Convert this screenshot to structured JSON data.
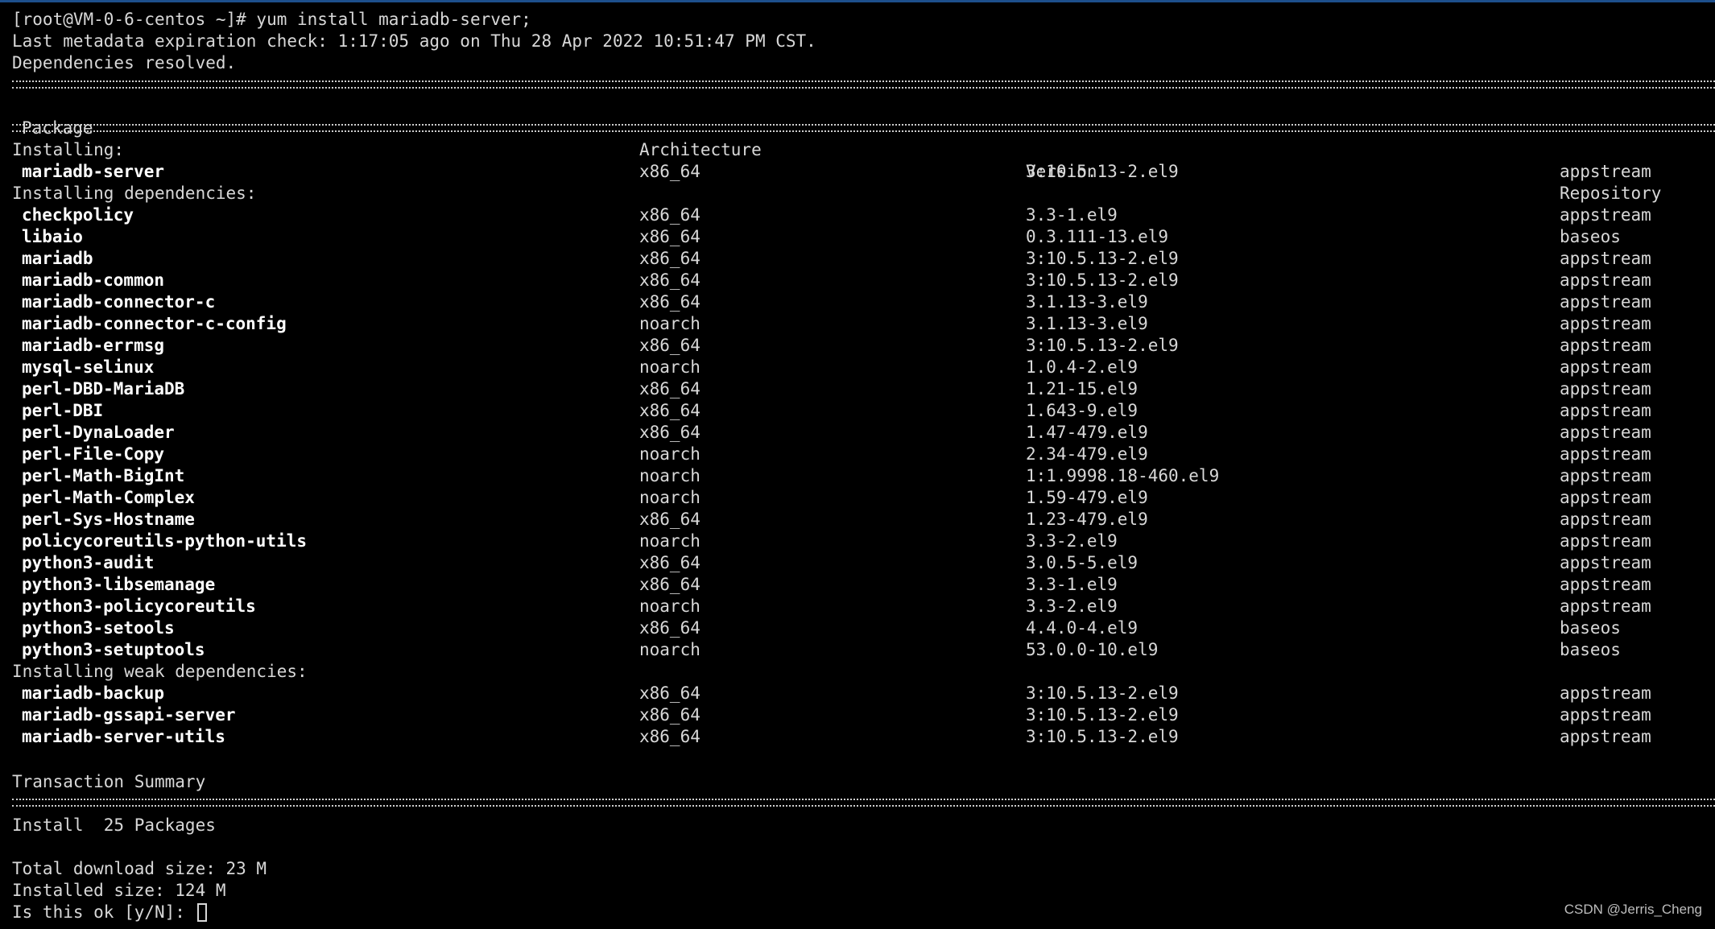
{
  "prompt_line": "[root@VM-0-6-centos ~]# yum install mariadb-server;",
  "metadata_line": "Last metadata expiration check: 1:17:05 ago on Thu 28 Apr 2022 10:51:47 PM CST.",
  "deps_resolved": "Dependencies resolved.",
  "table_headers": {
    "package": "Package",
    "architecture": "Architecture",
    "version": "Version",
    "repository": "Repository"
  },
  "sections": {
    "installing": "Installing:",
    "installing_dependencies": "Installing dependencies:",
    "installing_weak_dependencies": "Installing weak dependencies:"
  },
  "packages": {
    "installing": [
      {
        "name": "mariadb-server",
        "arch": "x86_64",
        "version": "3:10.5.13-2.el9",
        "repo": "appstream"
      }
    ],
    "dependencies": [
      {
        "name": "checkpolicy",
        "arch": "x86_64",
        "version": "3.3-1.el9",
        "repo": "appstream"
      },
      {
        "name": "libaio",
        "arch": "x86_64",
        "version": "0.3.111-13.el9",
        "repo": "baseos"
      },
      {
        "name": "mariadb",
        "arch": "x86_64",
        "version": "3:10.5.13-2.el9",
        "repo": "appstream"
      },
      {
        "name": "mariadb-common",
        "arch": "x86_64",
        "version": "3:10.5.13-2.el9",
        "repo": "appstream"
      },
      {
        "name": "mariadb-connector-c",
        "arch": "x86_64",
        "version": "3.1.13-3.el9",
        "repo": "appstream"
      },
      {
        "name": "mariadb-connector-c-config",
        "arch": "noarch",
        "version": "3.1.13-3.el9",
        "repo": "appstream"
      },
      {
        "name": "mariadb-errmsg",
        "arch": "x86_64",
        "version": "3:10.5.13-2.el9",
        "repo": "appstream"
      },
      {
        "name": "mysql-selinux",
        "arch": "noarch",
        "version": "1.0.4-2.el9",
        "repo": "appstream"
      },
      {
        "name": "perl-DBD-MariaDB",
        "arch": "x86_64",
        "version": "1.21-15.el9",
        "repo": "appstream"
      },
      {
        "name": "perl-DBI",
        "arch": "x86_64",
        "version": "1.643-9.el9",
        "repo": "appstream"
      },
      {
        "name": "perl-DynaLoader",
        "arch": "x86_64",
        "version": "1.47-479.el9",
        "repo": "appstream"
      },
      {
        "name": "perl-File-Copy",
        "arch": "noarch",
        "version": "2.34-479.el9",
        "repo": "appstream"
      },
      {
        "name": "perl-Math-BigInt",
        "arch": "noarch",
        "version": "1:1.9998.18-460.el9",
        "repo": "appstream"
      },
      {
        "name": "perl-Math-Complex",
        "arch": "noarch",
        "version": "1.59-479.el9",
        "repo": "appstream"
      },
      {
        "name": "perl-Sys-Hostname",
        "arch": "x86_64",
        "version": "1.23-479.el9",
        "repo": "appstream"
      },
      {
        "name": "policycoreutils-python-utils",
        "arch": "noarch",
        "version": "3.3-2.el9",
        "repo": "appstream"
      },
      {
        "name": "python3-audit",
        "arch": "x86_64",
        "version": "3.0.5-5.el9",
        "repo": "appstream"
      },
      {
        "name": "python3-libsemanage",
        "arch": "x86_64",
        "version": "3.3-1.el9",
        "repo": "appstream"
      },
      {
        "name": "python3-policycoreutils",
        "arch": "noarch",
        "version": "3.3-2.el9",
        "repo": "appstream"
      },
      {
        "name": "python3-setools",
        "arch": "x86_64",
        "version": "4.4.0-4.el9",
        "repo": "baseos"
      },
      {
        "name": "python3-setuptools",
        "arch": "noarch",
        "version": "53.0.0-10.el9",
        "repo": "baseos"
      }
    ],
    "weak_dependencies": [
      {
        "name": "mariadb-backup",
        "arch": "x86_64",
        "version": "3:10.5.13-2.el9",
        "repo": "appstream"
      },
      {
        "name": "mariadb-gssapi-server",
        "arch": "x86_64",
        "version": "3:10.5.13-2.el9",
        "repo": "appstream"
      },
      {
        "name": "mariadb-server-utils",
        "arch": "x86_64",
        "version": "3:10.5.13-2.el9",
        "repo": "appstream"
      }
    ]
  },
  "summary": {
    "title": "Transaction Summary",
    "install_line": "Install  25 Packages",
    "download_size": "Total download size: 23 M",
    "installed_size": "Installed size: 124 M",
    "prompt": "Is this ok [y/N]: "
  },
  "watermark": "CSDN @Jerris_Cheng"
}
